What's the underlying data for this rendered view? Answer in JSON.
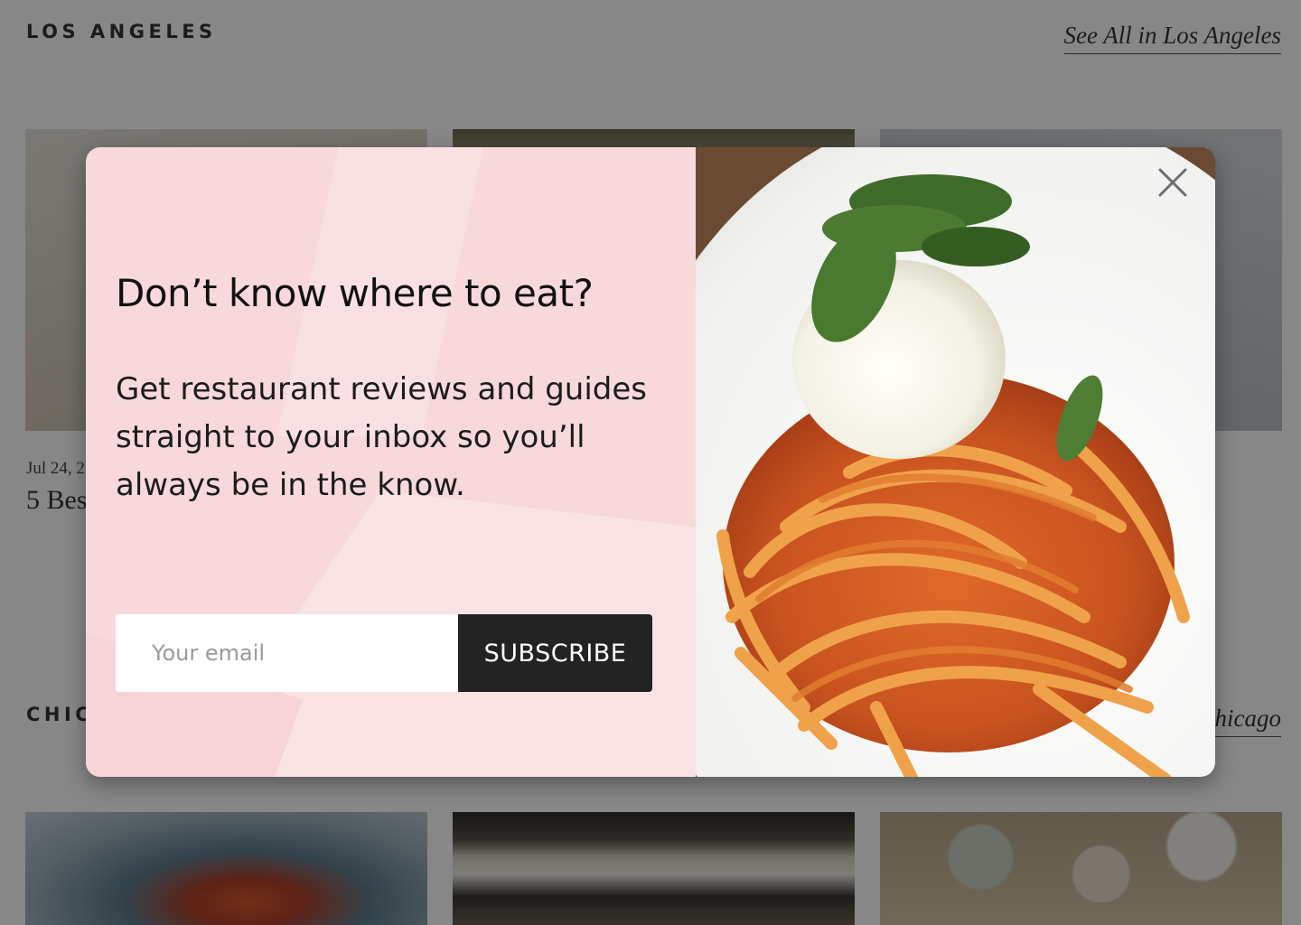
{
  "background": {
    "los_angeles": {
      "title": "LOS ANGELES",
      "see_all": "See All in Los Angeles",
      "card": {
        "date": "Jul 24, 2",
        "title": "5 Best"
      }
    },
    "chicago": {
      "title": "CHICAGO",
      "see_all": "See All in Chicago"
    }
  },
  "modal": {
    "heading": "Don’t know where to eat?",
    "body": "Get restaurant reviews and guides straight to your inbox so you’ll always be in the know.",
    "email_placeholder": "Your email",
    "subscribe_label": "SUBSCRIBE",
    "close_icon": "close-icon",
    "image": "pasta-with-burrata-photo"
  },
  "colors": {
    "overlay": "rgba(0,0,0,0.47)",
    "modal_pink": "#f7d9dc",
    "button_dark": "#232323"
  }
}
